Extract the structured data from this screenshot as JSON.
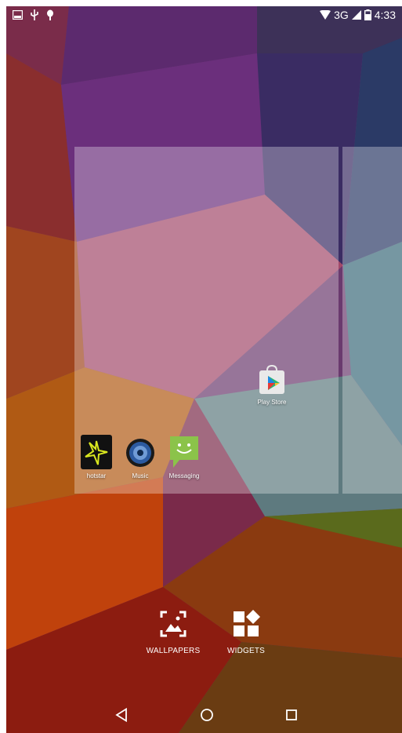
{
  "status_bar": {
    "left_icons": [
      "image-icon",
      "usb-icon",
      "debug-icon"
    ],
    "network": "3G",
    "time": "4:33",
    "right_icons": [
      "wifi-icon",
      "signal-icon",
      "battery-icon"
    ]
  },
  "workspace": {
    "apps": [
      {
        "label": "Play Store",
        "icon": "play-store-icon"
      },
      {
        "label": "hotstar",
        "icon": "hotstar-icon"
      },
      {
        "label": "Music",
        "icon": "music-icon"
      },
      {
        "label": "Messaging",
        "icon": "messaging-icon"
      }
    ]
  },
  "overview_options": [
    {
      "label": "WALLPAPERS",
      "icon": "wallpapers-icon"
    },
    {
      "label": "WIDGETS",
      "icon": "widgets-icon"
    }
  ],
  "nav_bar": [
    "back-icon",
    "home-icon",
    "recents-icon"
  ],
  "colors": {
    "panel_overlay": "rgba(255,255,255,0.30)",
    "play_store_bag": "#e9e9e9",
    "hotstar_bg": "#111111",
    "hotstar_star": "#d8e61f",
    "messaging_green": "#8bc34a",
    "music_blue": "#2c5aa0"
  }
}
